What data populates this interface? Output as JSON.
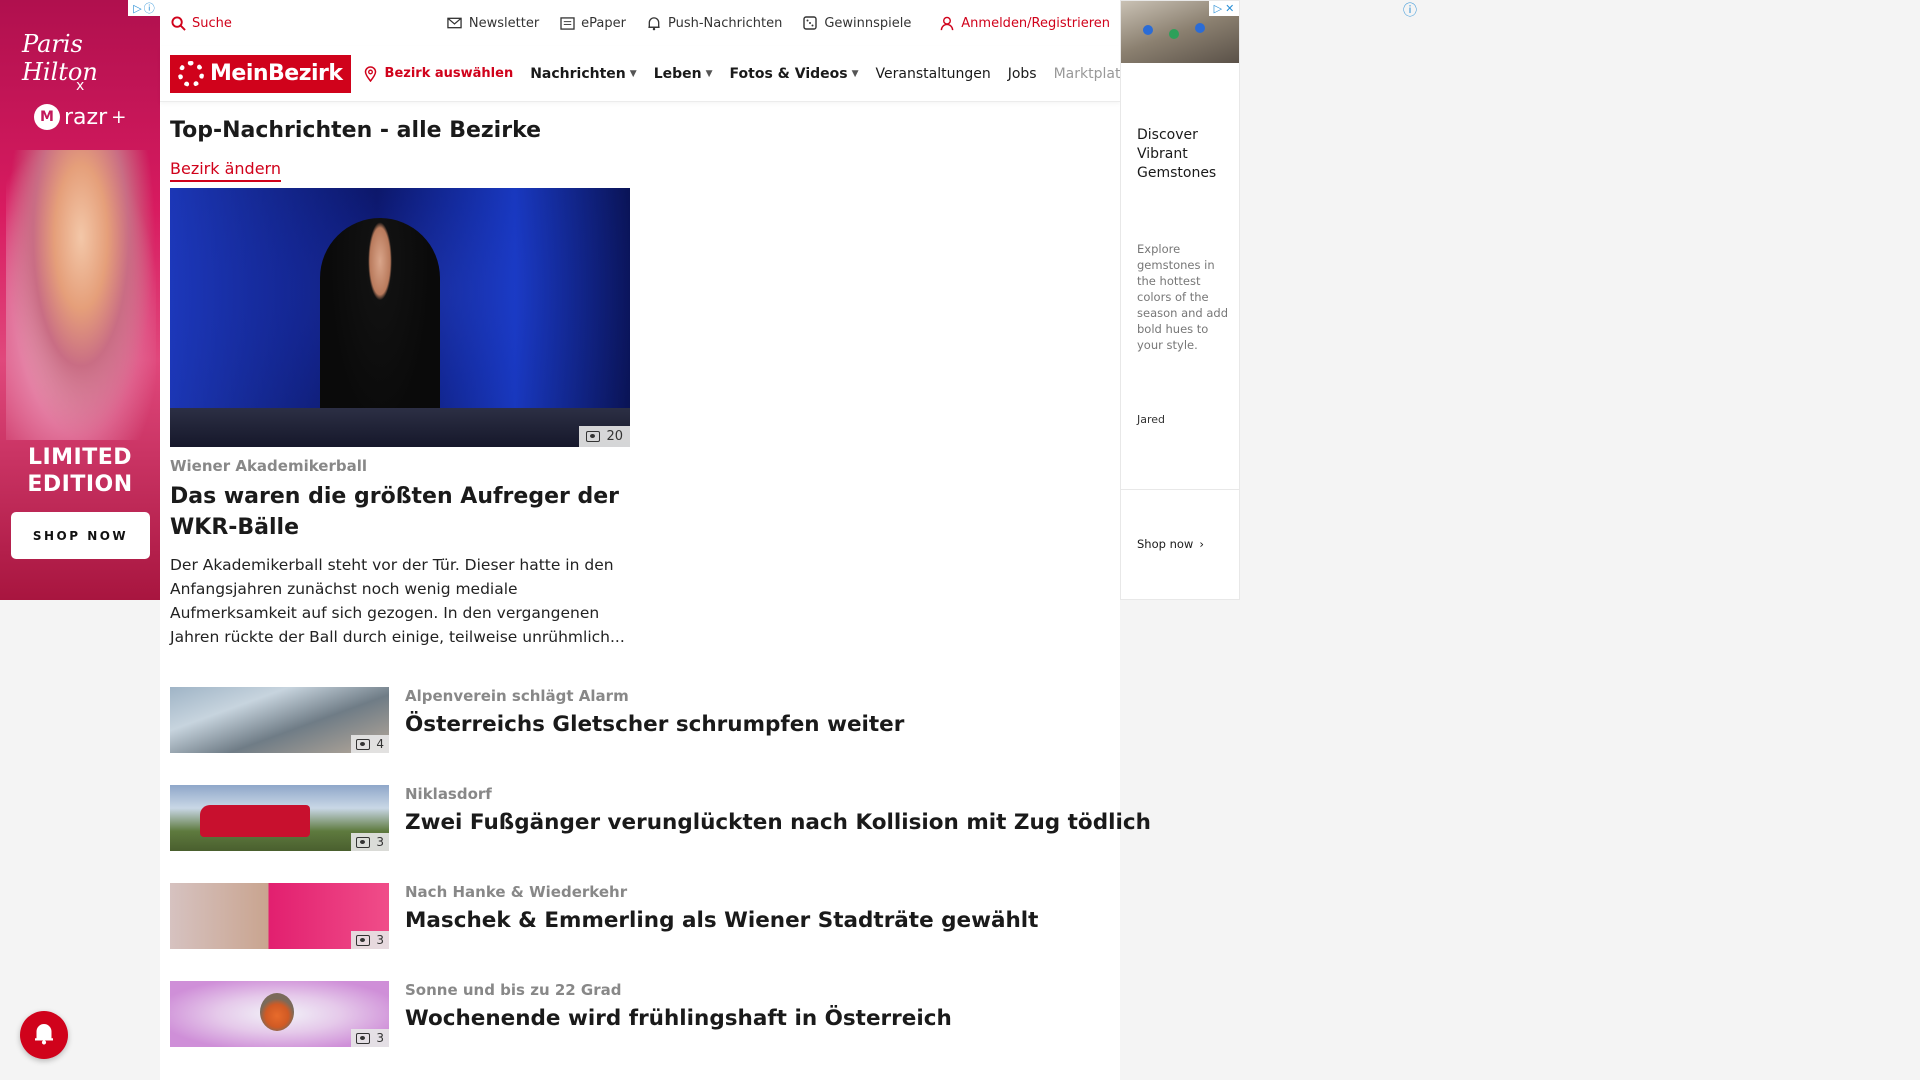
{
  "left_ad": {
    "brand": "Paris Hilton",
    "x": "x",
    "partner": "razr",
    "partner_sup": "+",
    "headline_line1": "LIMITED",
    "headline_line2": "EDITION",
    "cta": "SHOP NOW"
  },
  "topbar": {
    "search": "Suche",
    "newsletter": "Newsletter",
    "epaper": "ePaper",
    "push": "Push-Nachrichten",
    "gewinnspiele": "Gewinnspiele",
    "login": "Anmelden/Registrieren"
  },
  "nav": {
    "logo": "MeinBezirk",
    "bezirk": "Bezirk auswählen",
    "items": [
      "Nachrichten",
      "Leben",
      "Fotos & Videos",
      "Veranstaltungen",
      "Jobs",
      "Marktplatz"
    ]
  },
  "main": {
    "section_title": "Top-Nachrichten - alle Bezirke",
    "change_link": "Bezirk ändern",
    "hero": {
      "photo_count": "20",
      "kicker": "Wiener Akademikerball",
      "title": "Das waren die größten Aufreger der WKR-Bälle",
      "teaser": "Der Akademikerball steht vor der Tür. Dieser hatte in den Anfangsjahren zunächst noch wenig mediale Aufmerksamkeit auf sich gezogen. In den vergangenen Jahren rückte der Ball durch einige, teilweise unrühmlich..."
    },
    "articles": [
      {
        "kicker": "Alpenverein schlägt Alarm",
        "title": "Österreichs Gletscher schrumpfen weiter",
        "photo_count": "4"
      },
      {
        "kicker": "Niklasdorf",
        "title": "Zwei Fußgänger verunglückten nach Kollision mit Zug tödlich",
        "photo_count": "3"
      },
      {
        "kicker": "Nach Hanke & Wiederkehr",
        "title": "Maschek & Emmerling als Wiener Stadträte gewählt",
        "photo_count": "3"
      },
      {
        "kicker": "Sonne und bis zu 22 Grad",
        "title": "Wochenende wird frühlingshaft in Österreich",
        "photo_count": "3"
      }
    ]
  },
  "right_ad": {
    "headline": "Discover Vibrant Gemstones",
    "body": "Explore gemstones in the hottest colors of the season and add bold hues to your style.",
    "advertiser": "Jared",
    "cta": "Shop now"
  },
  "colors": {
    "brand_red": "#d0021b",
    "adchoice_blue": "#2a8fd6"
  }
}
